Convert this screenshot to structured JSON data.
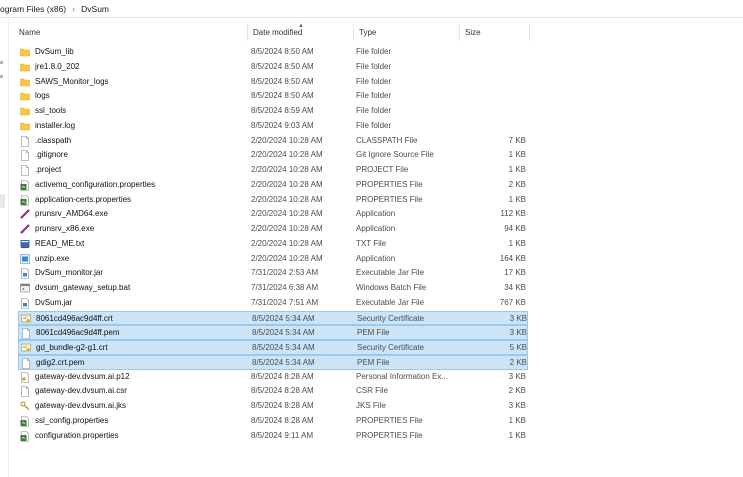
{
  "breadcrumb": {
    "items": [
      "ogram Files (x86)",
      "DvSum"
    ],
    "separator": "›"
  },
  "columns": {
    "name": "Name",
    "date": "Date modified",
    "type": "Type",
    "size": "Size"
  },
  "files": [
    {
      "name": "DvSum_lib",
      "date": "8/5/2024 8:50 AM",
      "type": "File folder",
      "size": "",
      "icon": "folder-icon",
      "selected": false
    },
    {
      "name": "jre1.8.0_202",
      "date": "8/5/2024 8:50 AM",
      "type": "File folder",
      "size": "",
      "icon": "folder-icon",
      "selected": false
    },
    {
      "name": "SAWS_Monitor_logs",
      "date": "8/5/2024 8:50 AM",
      "type": "File folder",
      "size": "",
      "icon": "folder-icon",
      "selected": false
    },
    {
      "name": "logs",
      "date": "8/5/2024 8:50 AM",
      "type": "File folder",
      "size": "",
      "icon": "folder-icon",
      "selected": false
    },
    {
      "name": "ssl_tools",
      "date": "8/5/2024 8:59 AM",
      "type": "File folder",
      "size": "",
      "icon": "folder-icon",
      "selected": false
    },
    {
      "name": "installer.log",
      "date": "8/5/2024 9:03 AM",
      "type": "File folder",
      "size": "",
      "icon": "folder-icon",
      "selected": false
    },
    {
      "name": ".classpath",
      "date": "2/20/2024 10:28 AM",
      "type": "CLASSPATH File",
      "size": "7 KB",
      "icon": "document-icon",
      "selected": false
    },
    {
      "name": ".gitignore",
      "date": "2/20/2024 10:28 AM",
      "type": "Git Ignore Source File",
      "size": "1 KB",
      "icon": "document-icon",
      "selected": false
    },
    {
      "name": ".project",
      "date": "2/20/2024 10:28 AM",
      "type": "PROJECT File",
      "size": "1 KB",
      "icon": "document-icon",
      "selected": false
    },
    {
      "name": "activemq_configuration.properties",
      "date": "2/20/2024 10:28 AM",
      "type": "PROPERTIES File",
      "size": "2 KB",
      "icon": "properties-icon",
      "selected": false
    },
    {
      "name": "application-certs.properties",
      "date": "2/20/2024 10:28 AM",
      "type": "PROPERTIES File",
      "size": "1 KB",
      "icon": "properties-icon",
      "selected": false
    },
    {
      "name": "prunsrv_AMD64.exe",
      "date": "2/20/2024 10:28 AM",
      "type": "Application",
      "size": "112 KB",
      "icon": "app-exe-icon",
      "selected": false
    },
    {
      "name": "prunsrv_x86.exe",
      "date": "2/20/2024 10:28 AM",
      "type": "Application",
      "size": "94 KB",
      "icon": "app-exe-icon",
      "selected": false
    },
    {
      "name": "READ_ME.txt",
      "date": "2/20/2024 10:28 AM",
      "type": "TXT File",
      "size": "1 KB",
      "icon": "text-file-icon",
      "selected": false
    },
    {
      "name": "unzip.exe",
      "date": "2/20/2024 10:28 AM",
      "type": "Application",
      "size": "164 KB",
      "icon": "installer-exe-icon",
      "selected": false
    },
    {
      "name": "DvSum_monitor.jar",
      "date": "7/31/2024 2:53 AM",
      "type": "Executable Jar File",
      "size": "17 KB",
      "icon": "jar-icon",
      "selected": false
    },
    {
      "name": "dvsum_gateway_setup.bat",
      "date": "7/31/2024 6:38 AM",
      "type": "Windows Batch File",
      "size": "34 KB",
      "icon": "batch-icon",
      "selected": false
    },
    {
      "name": "DvSum.jar",
      "date": "7/31/2024 7:51 AM",
      "type": "Executable Jar File",
      "size": "767 KB",
      "icon": "jar-icon",
      "selected": false
    },
    {
      "name": "8061cd496ac9d4ff.crt",
      "date": "8/5/2024 5:34 AM",
      "type": "Security Certificate",
      "size": "3 KB",
      "icon": "certificate-icon",
      "selected": true
    },
    {
      "name": "8061cd496ac9d4ff.pem",
      "date": "8/5/2024 5:34 AM",
      "type": "PEM File",
      "size": "3 KB",
      "icon": "document-icon",
      "selected": true
    },
    {
      "name": "gd_bundle-g2-g1.crt",
      "date": "8/5/2024 5:34 AM",
      "type": "Security Certificate",
      "size": "5 KB",
      "icon": "certificate-icon",
      "selected": true
    },
    {
      "name": "gdig2.crt.pem",
      "date": "8/5/2024 5:34 AM",
      "type": "PEM File",
      "size": "2 KB",
      "icon": "document-icon",
      "selected": true
    },
    {
      "name": "gateway-dev.dvsum.ai.p12",
      "date": "8/5/2024 8:28 AM",
      "type": "Personal Information Ex...",
      "size": "3 KB",
      "icon": "personal-info-icon",
      "selected": false
    },
    {
      "name": "gateway-dev.dvsum.ai.csr",
      "date": "8/5/2024 8:28 AM",
      "type": "CSR File",
      "size": "2 KB",
      "icon": "document-icon",
      "selected": false
    },
    {
      "name": "gateway-dev.dvsum.ai.jks",
      "date": "8/5/2024 8:28 AM",
      "type": "JKS File",
      "size": "3 KB",
      "icon": "key-file-icon",
      "selected": false
    },
    {
      "name": "ssl_config.properties",
      "date": "8/5/2024 8:28 AM",
      "type": "PROPERTIES File",
      "size": "1 KB",
      "icon": "properties-icon",
      "selected": false
    },
    {
      "name": "configuration.properties",
      "date": "8/5/2024 9:11 AM",
      "type": "PROPERTIES File",
      "size": "1 KB",
      "icon": "properties-icon",
      "selected": false
    }
  ],
  "colors": {
    "folder": "#f7c846",
    "selection": "#cce4f7",
    "selection_border": "#99c9ef"
  }
}
